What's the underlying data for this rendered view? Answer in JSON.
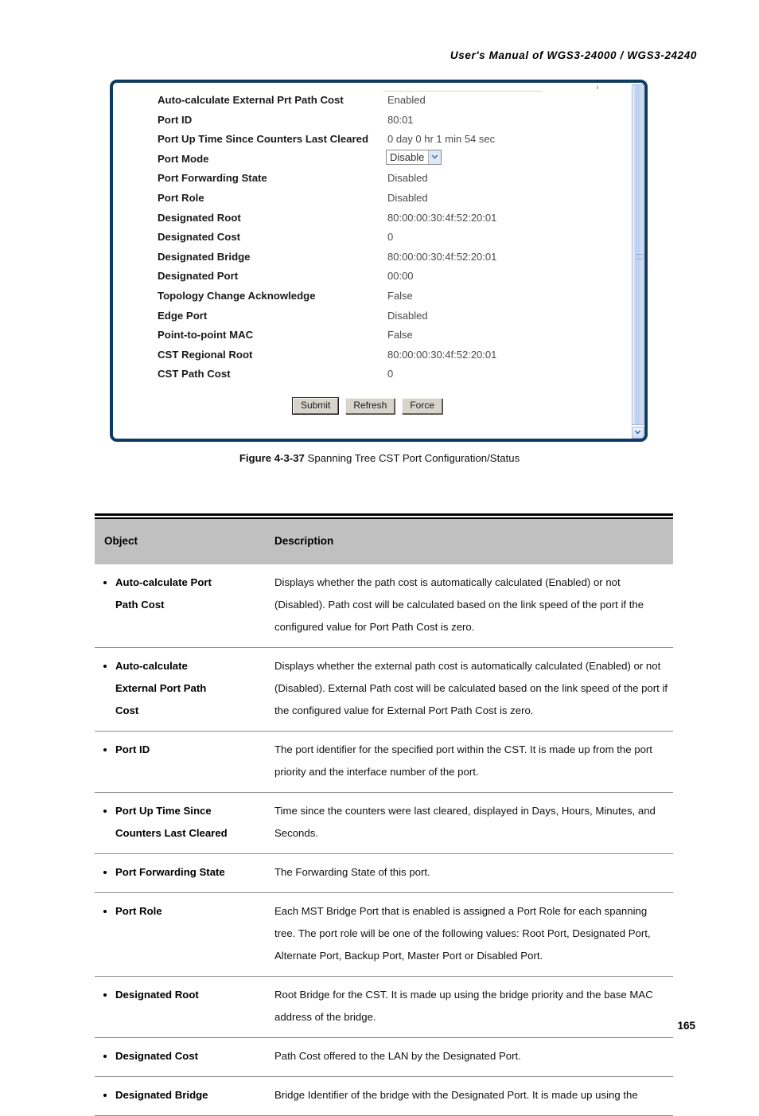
{
  "header": {
    "manual_title": "User's Manual of WGS3-24000 / WGS3-24240"
  },
  "screenshot": {
    "rows": [
      {
        "label": "Auto-calculate External Prt Path Cost",
        "value": "Enabled",
        "type": "text"
      },
      {
        "label": "Port ID",
        "value": "80:01",
        "type": "text"
      },
      {
        "label": "Port Up Time Since Counters Last Cleared",
        "value": "0 day 0 hr 1 min 54 sec",
        "type": "text"
      },
      {
        "label": "Port Mode",
        "value": "Disable",
        "type": "select"
      },
      {
        "label": "Port Forwarding State",
        "value": "Disabled",
        "type": "text"
      },
      {
        "label": "Port Role",
        "value": "Disabled",
        "type": "text"
      },
      {
        "label": "Designated Root",
        "value": "80:00:00:30:4f:52:20:01",
        "type": "text"
      },
      {
        "label": "Designated Cost",
        "value": "0",
        "type": "text"
      },
      {
        "label": "Designated Bridge",
        "value": "80:00:00:30:4f:52:20:01",
        "type": "text"
      },
      {
        "label": "Designated Port",
        "value": "00:00",
        "type": "text"
      },
      {
        "label": "Topology Change Acknowledge",
        "value": "False",
        "type": "text"
      },
      {
        "label": "Edge Port",
        "value": "Disabled",
        "type": "text"
      },
      {
        "label": "Point-to-point MAC",
        "value": "False",
        "type": "text"
      },
      {
        "label": "CST Regional Root",
        "value": "80:00:00:30:4f:52:20:01",
        "type": "text"
      },
      {
        "label": "CST Path Cost",
        "value": "0",
        "type": "text"
      }
    ],
    "buttons": {
      "submit": "Submit",
      "refresh": "Refresh",
      "force": "Force"
    },
    "colors": {
      "frame": "#103a60",
      "scrollbar_thumb": "#c6d6f2"
    }
  },
  "figure": {
    "number": "Figure 4-3-37",
    "caption": "Spanning Tree CST Port Configuration/Status"
  },
  "table": {
    "headers": {
      "object": "Object",
      "description": "Description"
    },
    "rows": [
      {
        "object_lines": [
          "Auto-calculate Port",
          "Path Cost"
        ],
        "description": "Displays whether the path cost is automatically calculated (Enabled) or not (Disabled). Path cost will be calculated based on the link speed of the port if the configured value for Port Path Cost is zero."
      },
      {
        "object_lines": [
          "Auto-calculate",
          "External Port Path",
          "Cost"
        ],
        "description": "Displays whether the external path cost is automatically calculated (Enabled) or not (Disabled). External Path cost will be calculated based on the link speed of the port if the configured value for External Port Path Cost is zero."
      },
      {
        "object_lines": [
          "Port ID"
        ],
        "description": "The port identifier for the specified port within the CST. It is made up from the port priority and the interface number of the port."
      },
      {
        "object_lines": [
          "Port Up Time Since",
          "Counters Last Cleared"
        ],
        "description": "Time since the counters were last cleared, displayed in Days, Hours, Minutes, and Seconds."
      },
      {
        "object_lines": [
          "Port Forwarding State"
        ],
        "description": "The Forwarding State of this port."
      },
      {
        "object_lines": [
          "Port Role"
        ],
        "description": "Each MST Bridge Port that is enabled is assigned a Port Role for each spanning tree. The port role will be one of the following values: Root Port, Designated Port, Alternate Port, Backup Port, Master Port or Disabled Port."
      },
      {
        "object_lines": [
          "Designated Root"
        ],
        "description": "Root Bridge for the CST. It is made up using the bridge priority and the base MAC address of the bridge."
      },
      {
        "object_lines": [
          "Designated Cost"
        ],
        "description": "Path Cost offered to the LAN by the Designated Port."
      },
      {
        "object_lines": [
          "Designated Bridge"
        ],
        "description": "Bridge Identifier of the bridge with the Designated Port. It is made up using the"
      }
    ]
  },
  "footer": {
    "page_number": "165"
  }
}
